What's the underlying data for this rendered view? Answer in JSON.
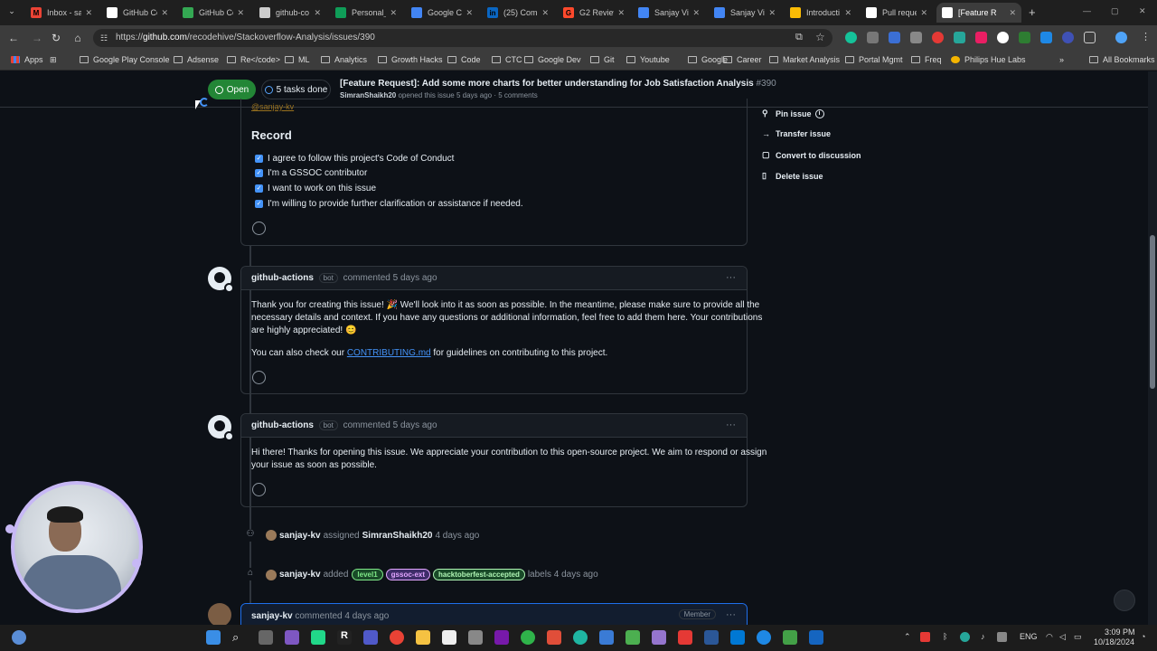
{
  "browser": {
    "tabs": [
      {
        "title": "Inbox - sa",
        "color": "#ea4335",
        "glyph": "M"
      },
      {
        "title": "GitHub Co",
        "color": "#ffffff",
        "glyph": ""
      },
      {
        "title": "GitHub Co",
        "color": "#34a853",
        "glyph": ""
      },
      {
        "title": "github-co",
        "color": "#cccccc",
        "glyph": ""
      },
      {
        "title": "Personal_F",
        "color": "#0f9d58",
        "glyph": ""
      },
      {
        "title": "Google Ca",
        "color": "#4285f4",
        "glyph": ""
      },
      {
        "title": "(25) Comm",
        "color": "#0a66c2",
        "glyph": "in"
      },
      {
        "title": "G2 Review",
        "color": "#ff492c",
        "glyph": "G"
      },
      {
        "title": "Sanjay Vis",
        "color": "#4285f4",
        "glyph": ""
      },
      {
        "title": "Sanjay Vis",
        "color": "#4285f4",
        "glyph": ""
      },
      {
        "title": "Introducti",
        "color": "#fbbc05",
        "glyph": ""
      },
      {
        "title": "Pull reque",
        "color": "#ffffff",
        "glyph": ""
      },
      {
        "title": "[Feature R",
        "color": "#ffffff",
        "glyph": ""
      }
    ],
    "new_tab": "+",
    "url_prefix": "https://",
    "url_domain": "github.com",
    "url_path": "/recodehive/Stackoverflow-Analysis/issues/390",
    "bookmarks": [
      "Apps",
      "Google Play Console",
      "Adsense",
      "Re</code>",
      "ML",
      "Analytics",
      "Growth Hacks",
      "Code",
      "CTC",
      "Google Dev",
      "Git",
      "Youtube",
      "Google",
      "Career",
      "Market Analysis",
      "Portal Mgmt",
      "Freq",
      "Philips Hue Labs"
    ],
    "all_bookmarks": "All Bookmarks"
  },
  "issue_header": {
    "status": "Open",
    "tasks": "5 tasks done",
    "title": "[Feature Request]: Add some more charts for better understanding for Job Satisfaction Analysis",
    "number": "#390",
    "author": "SimranShaikh20",
    "meta": "opened this issue 5 days ago · 5 comments"
  },
  "first_comment": {
    "mention": "@sanjay-kv",
    "heading": "Record",
    "checks": [
      "I agree to follow this project's Code of Conduct",
      "I'm a GSSOC contributor",
      "I want to work on this issue",
      "I'm willing to provide further clarification or assistance if needed."
    ]
  },
  "sidebar": {
    "pin": "Pin issue",
    "transfer": "Transfer issue",
    "convert": "Convert to discussion",
    "delete": "Delete issue"
  },
  "comment1": {
    "user": "github-actions",
    "badge": "bot",
    "meta": "commented 5 days ago",
    "line1": "Thank you for creating this issue! 🎉 We'll look into it as soon as possible. In the meantime, please make sure to provide all the",
    "line2": "necessary details and context. If you have any questions or additional information, feel free to add them here. Your contributions",
    "line3": "are highly appreciated! 😊",
    "line4_pre": "You can also check our",
    "line4_link": "CONTRIBUTING.md",
    "line4_post": "for guidelines on contributing to this project."
  },
  "comment2": {
    "user": "github-actions",
    "badge": "bot",
    "meta": "commented 5 days ago",
    "line1": "Hi there! Thanks for opening this issue. We appreciate your contribution to this open-source project. We aim to respond or assign",
    "line2": "your issue as soon as possible."
  },
  "events": {
    "assigned_user": "sanjay-kv",
    "assigned_verb": "assigned",
    "assignee": "SimranShaikh20",
    "assigned_time": "4 days ago",
    "labeled_user": "sanjay-kv",
    "labeled_verb": "added",
    "labels": [
      {
        "name": "level1",
        "bg": "#2ea04366",
        "fg": "#7ee787"
      },
      {
        "name": "gssoc-ext",
        "bg": "#8957e566",
        "fg": "#e2a5ff"
      },
      {
        "name": "hacktoberfest-accepted",
        "bg": "#2ea04366",
        "fg": "#aff5b4"
      }
    ],
    "labels_suffix": "labels 4 days ago"
  },
  "comment3": {
    "user": "sanjay-kv",
    "meta": "commented 4 days ago",
    "role": "Member"
  },
  "taskbar": {
    "lang": "ENG",
    "time": "3:09 PM",
    "date": "10/18/2024"
  }
}
